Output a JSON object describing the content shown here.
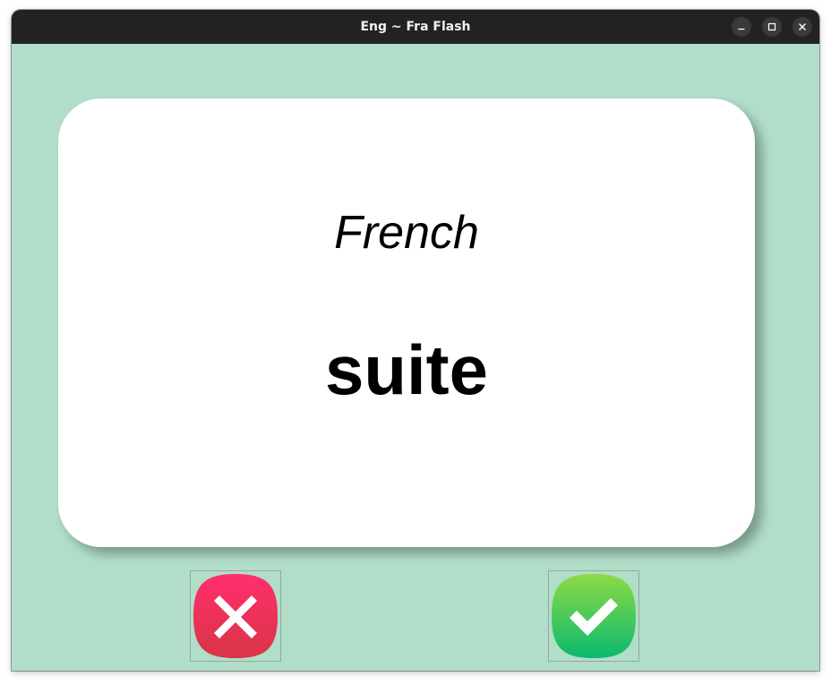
{
  "window": {
    "title": "Eng ~ Fra Flash"
  },
  "card": {
    "language": "French",
    "word": "suite"
  },
  "buttons": {
    "wrong_icon": "cross-icon",
    "right_icon": "checkmark-icon"
  },
  "colors": {
    "background": "#b1dec8",
    "card": "#ffffff",
    "wrong": "#e83457",
    "right": "#3ccb5a"
  }
}
